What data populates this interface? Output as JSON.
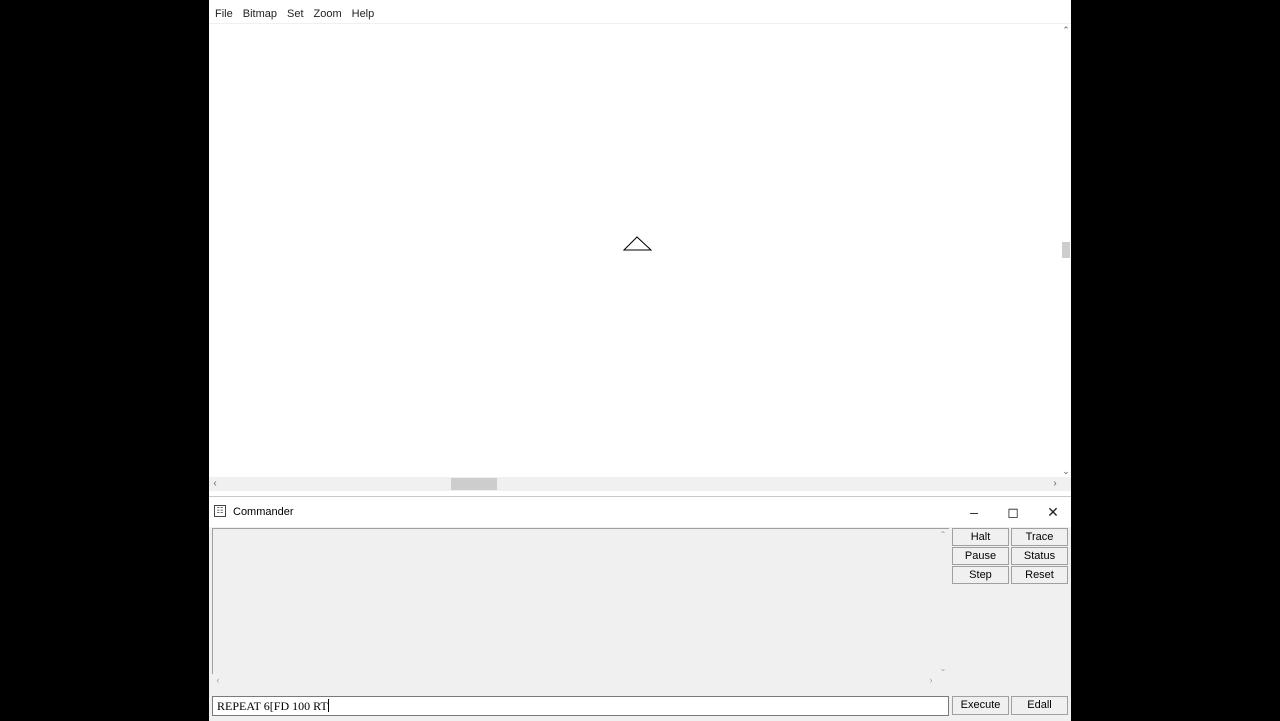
{
  "menu": {
    "items": [
      {
        "label": "File"
      },
      {
        "label": "Bitmap"
      },
      {
        "label": "Set"
      },
      {
        "label": "Zoom"
      },
      {
        "label": "Help"
      }
    ]
  },
  "commander": {
    "title": "Commander",
    "buttons": {
      "halt": "Halt",
      "trace": "Trace",
      "pause": "Pause",
      "status": "Status",
      "step": "Step",
      "reset": "Reset",
      "execute": "Execute",
      "edall": "Edall"
    },
    "input_value": "REPEAT 6[FD 100 RT"
  },
  "icons": {
    "turtle": "turtle-triangle-icon",
    "minimize": "minimize-icon",
    "maximize": "maximize-icon",
    "close": "close-icon"
  },
  "colors": {
    "window_background": "#ffffff",
    "panel_background": "#f0f0f0",
    "desktop_background": "#000000"
  }
}
